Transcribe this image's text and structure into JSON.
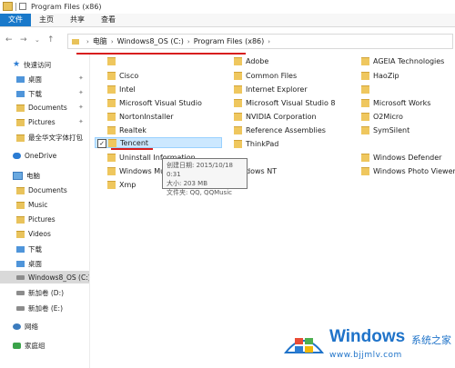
{
  "window": {
    "title": "Program Files (x86)"
  },
  "ribbon": {
    "tabs": [
      "文件",
      "主页",
      "共享",
      "查看"
    ]
  },
  "address": {
    "crumbs": [
      "电脑",
      "Windows8_OS (C:)",
      "Program Files (x86)"
    ]
  },
  "nav": {
    "items": [
      {
        "label": "快速访问",
        "icon": "star-icon"
      },
      {
        "label": "桌面",
        "icon": "desktop-icon"
      },
      {
        "label": "下载",
        "icon": "downloads-icon"
      },
      {
        "label": "Documents",
        "icon": "documents-icon"
      },
      {
        "label": "Pictures",
        "icon": "pictures-icon"
      },
      {
        "label": "最全华文字体打包",
        "icon": "folder-icon"
      },
      {
        "label": "OneDrive",
        "icon": "onedrive-icon"
      },
      {
        "label": "电脑",
        "icon": "pc-icon"
      },
      {
        "label": "Documents",
        "icon": "documents-icon"
      },
      {
        "label": "Music",
        "icon": "music-icon"
      },
      {
        "label": "Pictures",
        "icon": "pictures-icon"
      },
      {
        "label": "Videos",
        "icon": "videos-icon"
      },
      {
        "label": "下载",
        "icon": "downloads-icon"
      },
      {
        "label": "桌面",
        "icon": "desktop-icon"
      },
      {
        "label": "Windows8_OS (C:)",
        "icon": "drive-icon"
      },
      {
        "label": "新加卷 (D:)",
        "icon": "drive-icon"
      },
      {
        "label": "新加卷 (E:)",
        "icon": "drive-icon"
      },
      {
        "label": "网络",
        "icon": "network-icon"
      },
      {
        "label": "家庭组",
        "icon": "homegroup-icon"
      }
    ]
  },
  "files": {
    "col1": [
      "",
      "Cisco",
      "Intel",
      "Microsoft Visual Studio",
      "NortonInstaller",
      "Realtek",
      "Tencent",
      "Uninstall Information",
      "Windows Mult",
      "Xmp"
    ],
    "col2": [
      "Adobe",
      "Common Files",
      "Internet Explorer",
      "Microsoft Visual Studio 8",
      "NVIDIA Corporation",
      "Reference Assemblies",
      "ThinkPad",
      "",
      "dows NT"
    ],
    "col3": [
      "AGEIA Technologies",
      "HaoZip",
      "",
      "Microsoft Works",
      "O2Micro",
      "SymSilent",
      "",
      "Windows Defender",
      "Windows Photo Viewer"
    ]
  },
  "tooltip": {
    "line1": "创建日期: 2015/10/18 0:31",
    "line2": "大小: 203 MB",
    "line3": "文件夹: QQ, QQMusic"
  },
  "watermark": {
    "brand": "Windows",
    "sub": "系统之家",
    "url": "www.bjjmlv.com"
  },
  "colors": {
    "accent": "#1979ca",
    "highlight": "#d81e1e",
    "selection": "#cce8ff"
  }
}
